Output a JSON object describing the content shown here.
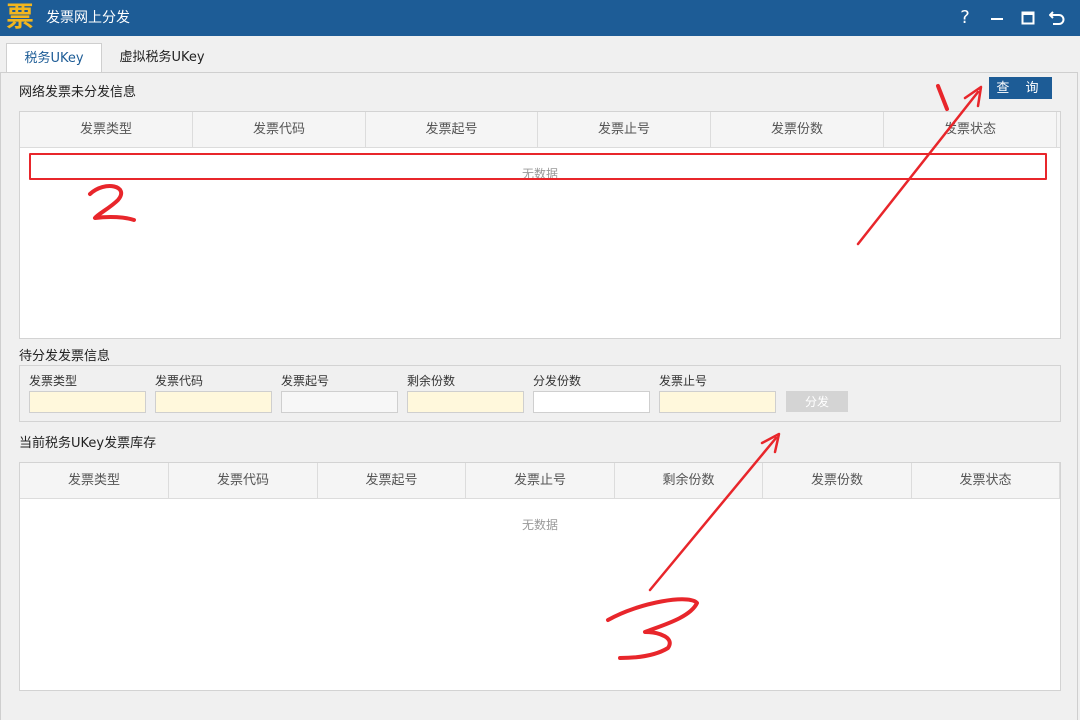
{
  "window": {
    "title": "发票网上分发",
    "icon_glyph": "票",
    "controls": {
      "help": "?"
    }
  },
  "tabs": [
    {
      "label": "税务UKey",
      "active": true
    },
    {
      "label": "虚拟税务UKey",
      "active": false
    }
  ],
  "online_section": {
    "title": "网络发票未分发信息",
    "query_label": "查 询",
    "columns": [
      "发票类型",
      "发票代码",
      "发票起号",
      "发票止号",
      "发票份数",
      "发票状态"
    ],
    "empty_text": "无数据"
  },
  "pending_section": {
    "title": "待分发发票信息",
    "fields": [
      {
        "label": "发票类型",
        "value": ""
      },
      {
        "label": "发票代码",
        "value": ""
      },
      {
        "label": "发票起号",
        "value": ""
      },
      {
        "label": "剩余份数",
        "value": ""
      },
      {
        "label": "分发份数",
        "value": ""
      },
      {
        "label": "发票止号",
        "value": ""
      }
    ],
    "distribute_label": "分发"
  },
  "stock_section": {
    "title": "当前税务UKey发票库存",
    "columns": [
      "发票类型",
      "发票代码",
      "发票起号",
      "发票止号",
      "剩余份数",
      "发票份数",
      "发票状态"
    ],
    "empty_text": "无数据"
  },
  "colors": {
    "titlebar": "#1d5c96",
    "accent": "#1d5c96",
    "icon": "#f2b61e",
    "annotation": "#e8262b",
    "readonly_field": "#fff8dc"
  },
  "icons": [
    "app-logo-icon",
    "help-icon",
    "minimize-icon",
    "maximize-icon",
    "restore-icon"
  ]
}
